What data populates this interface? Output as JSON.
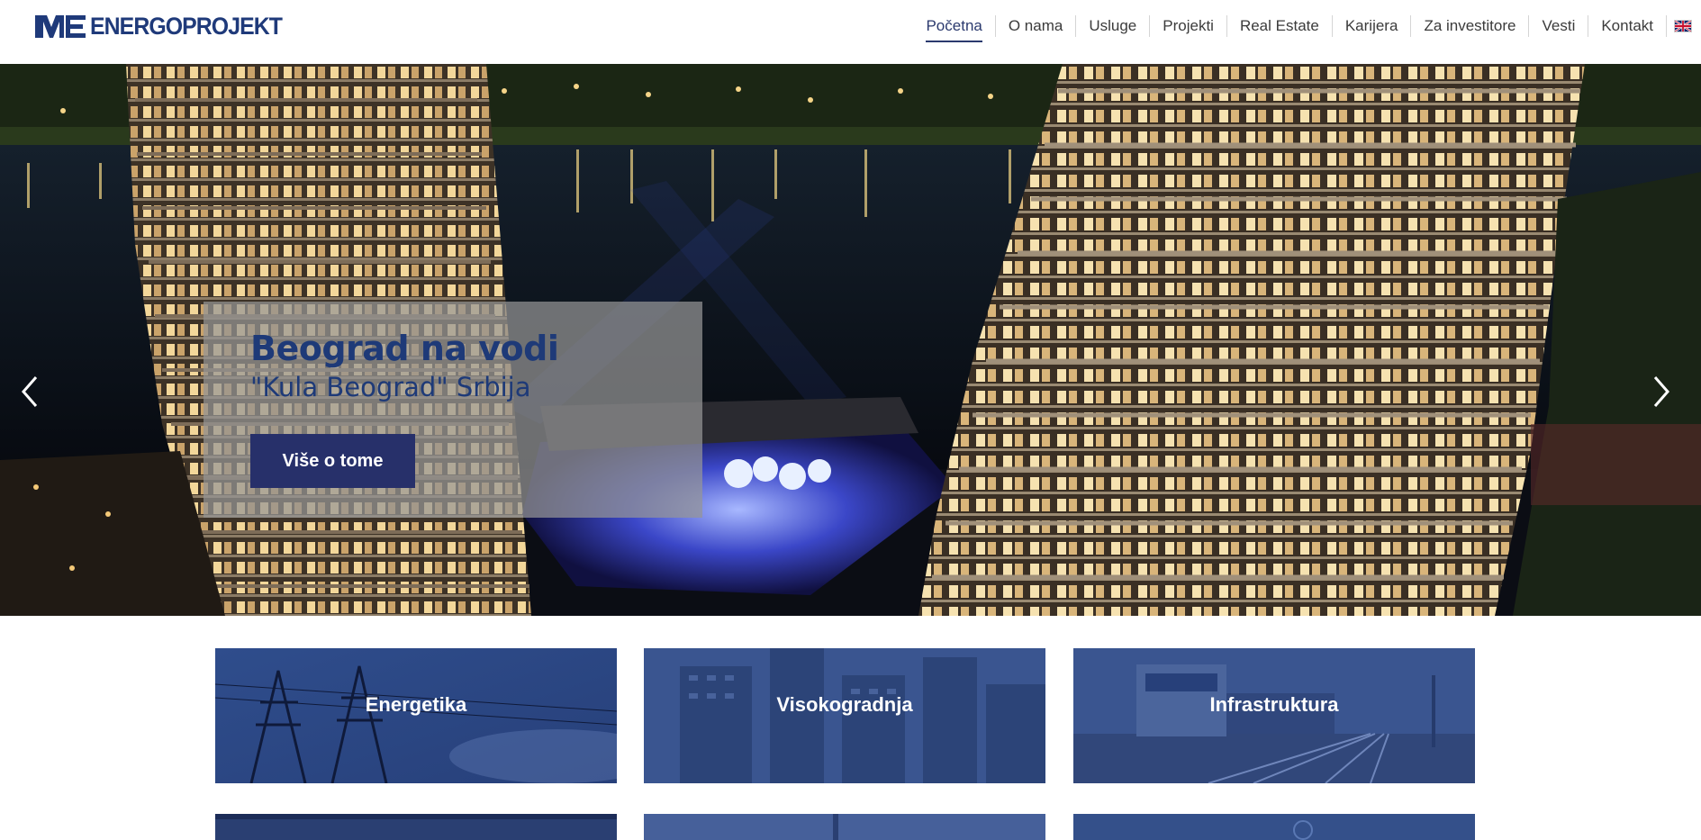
{
  "header": {
    "logo_text": "ENERGOPROJEKT",
    "brand_color": "#1f3a7a",
    "nav": [
      {
        "label": "Početna",
        "active": true
      },
      {
        "label": "O nama"
      },
      {
        "label": "Usluge"
      },
      {
        "label": "Projekti"
      },
      {
        "label": "Real Estate"
      },
      {
        "label": "Karijera"
      },
      {
        "label": "Za investitore"
      },
      {
        "label": "Vesti"
      },
      {
        "label": "Kontakt"
      }
    ],
    "language_icon": "uk-flag-icon"
  },
  "hero": {
    "title": "Beograd na vodi",
    "subtitle": "\"Kula Beograd\" Srbija",
    "button_label": "Više o tome",
    "button_color": "#27306a",
    "prev_icon": "chevron-left-icon",
    "next_icon": "chevron-right-icon"
  },
  "tiles": [
    {
      "label": "Energetika"
    },
    {
      "label": "Visokogradnja"
    },
    {
      "label": "Infrastruktura"
    }
  ]
}
